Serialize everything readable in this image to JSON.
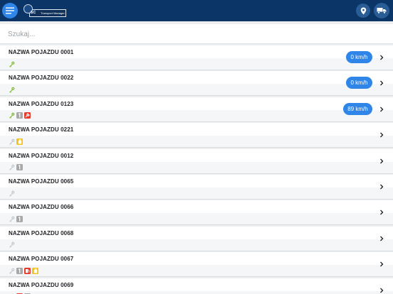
{
  "header": {
    "logo_brand": "SC",
    "logo_product": "Transport Manager",
    "menu_icon": "menu-icon",
    "location_icon": "location-pin-icon",
    "truck_icon": "truck-icon"
  },
  "search": {
    "placeholder": "Szukaj..."
  },
  "colors": {
    "header_bg": "#0a3566",
    "accent": "#2f86e8",
    "key_active": "#7cbc2a",
    "key_inactive": "#c4c7cb",
    "badge_grey": "#a8a8a8",
    "badge_red": "#e43c2f",
    "badge_yellow": "#f4c21c"
  },
  "vehicles": [
    {
      "name": "NAZWA POJAZDU 0001",
      "speed": "0 km/h",
      "key_active": true,
      "badges": []
    },
    {
      "name": "NAZWA POJAZDU 0022",
      "speed": "0 km/h",
      "key_active": true,
      "badges": []
    },
    {
      "name": "NAZWA POJAZDU 0123",
      "speed": "89 km/h",
      "key_active": true,
      "badges": [
        "grey",
        "red-wrench"
      ]
    },
    {
      "name": "NAZWA POJAZDU 0221",
      "speed": "",
      "key_active": false,
      "badges": [
        "yellow"
      ]
    },
    {
      "name": "NAZWA POJAZDU 0012",
      "speed": "",
      "key_active": false,
      "badges": [
        "grey"
      ]
    },
    {
      "name": "NAZWA POJAZDU 0065",
      "speed": "",
      "key_active": false,
      "badges": []
    },
    {
      "name": "NAZWA POJAZDU 0066",
      "speed": "",
      "key_active": false,
      "badges": [
        "grey"
      ]
    },
    {
      "name": "NAZWA POJAZDU 0068",
      "speed": "",
      "key_active": false,
      "badges": []
    },
    {
      "name": "NAZWA POJAZDU 0067",
      "speed": "",
      "key_active": false,
      "badges": [
        "grey",
        "red-fuel",
        "yellow"
      ]
    },
    {
      "name": "NAZWA POJAZDU 0069",
      "speed": "",
      "key_active": false,
      "badges": [
        "red-fuel",
        "grey"
      ]
    }
  ]
}
